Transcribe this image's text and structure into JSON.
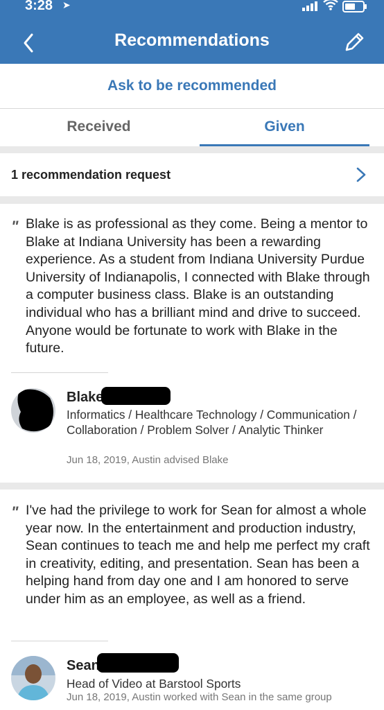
{
  "status_bar": {
    "time": "3:28"
  },
  "header": {
    "title": "Recommendations"
  },
  "ask_link": "Ask to be recommended",
  "tabs": [
    {
      "label": "Received",
      "selected": false
    },
    {
      "label": "Given",
      "selected": true
    }
  ],
  "request_row": {
    "label": "1 recommendation request"
  },
  "recommendations": [
    {
      "quote_mark": "\"",
      "text": "Blake is as professional as they come. Being a mentor to Blake at Indiana University has been a rewarding experience. As a student from Indiana University Purdue University of Indianapolis, I connected with Blake through a computer business class. Blake is an outstanding individual who has a brilliant mind and drive to succeed. Anyone would be fortunate to work with Blake in the future.",
      "name": "Blake",
      "headline": "Informatics / Healthcare Technology / Communication / Collaboration / Problem Solver / Analytic Thinker",
      "meta": "Jun 18, 2019, Austin advised Blake"
    },
    {
      "quote_mark": "\"",
      "text": "I've had the privilege to work for Sean for almost a whole year now. In the entertainment and production industry, Sean continues to teach me and help me perfect my craft in creativity, editing, and presentation. Sean has been a helping hand from day one and I am honored to serve under him as an employee, as well as a friend.",
      "name": "Sean",
      "headline": "Head of Video at Barstool Sports",
      "meta": "Jun 18, 2019, Austin worked with Sean in the same group"
    }
  ],
  "colors": {
    "brand_blue": "#3a78b7",
    "background": "#e9e9e9"
  },
  "icons": [
    "back-chevron-icon",
    "edit-pencil-icon",
    "chevron-right-icon",
    "quote-icon",
    "signal-icon",
    "wifi-icon",
    "battery-icon",
    "location-arrow-icon"
  ]
}
